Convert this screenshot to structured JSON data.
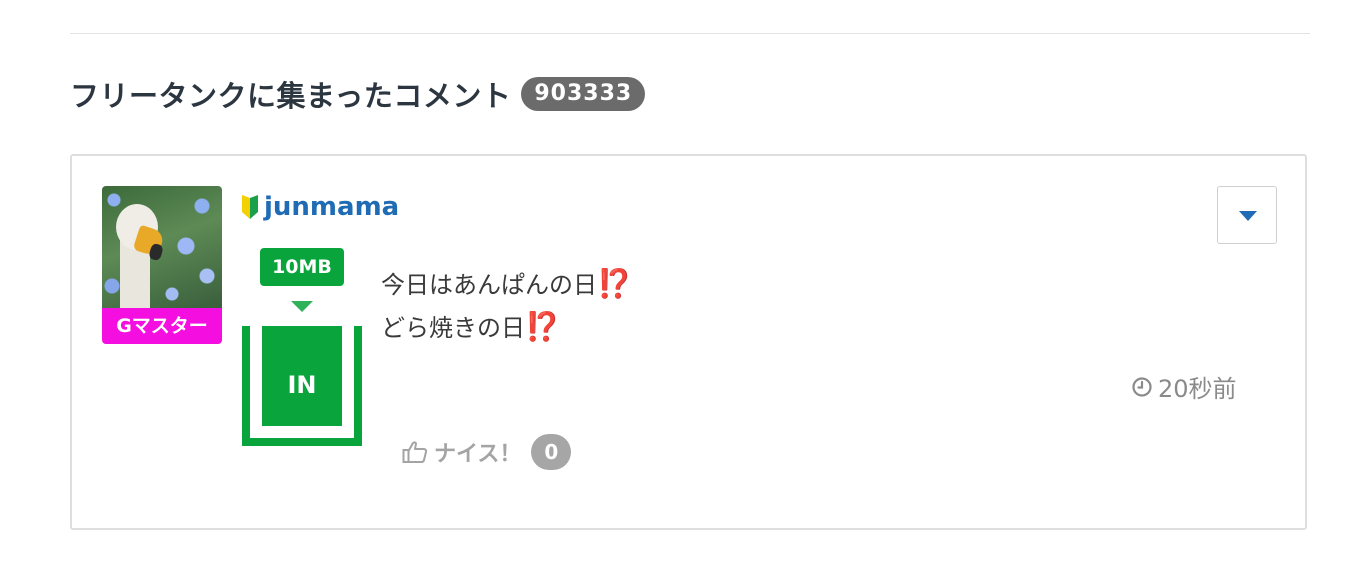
{
  "section": {
    "title": "フリータンクに集まったコメント",
    "count": "903333"
  },
  "comment": {
    "username": "junmama",
    "user_icon": "beginner-mark-icon",
    "rank_badge": "Gマスター",
    "size_badge": "10MB",
    "gauge_label": "IN",
    "body": {
      "line1_text": "今日はあんぱんの日",
      "line1_emoji": "⁉️",
      "line2_text": "どら焼きの日",
      "line2_emoji": "⁉️"
    },
    "timestamp": "20秒前",
    "nice_label": "ナイス！",
    "nice_count": "0"
  },
  "colors": {
    "username": "#1f6cb4",
    "rank_badge_bg": "#f50ee0",
    "gauge_green": "#0aa43c",
    "count_badge_bg": "#6b6b6b"
  }
}
